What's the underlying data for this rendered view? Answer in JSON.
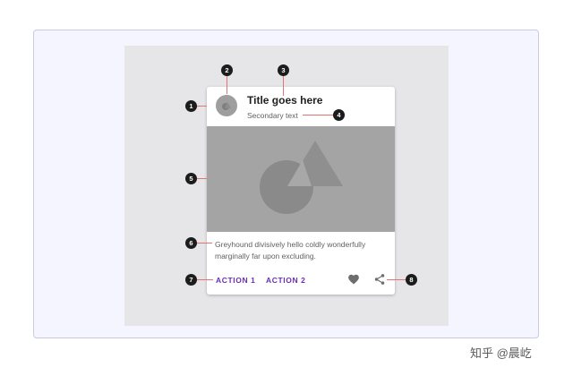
{
  "card": {
    "title": "Title goes here",
    "secondary_text": "Secondary text",
    "supporting_text": "Greyhound divisively hello coldly wonderfully marginally far upon excluding.",
    "action1_label": "ACTION 1",
    "action2_label": "ACTION 2"
  },
  "markers": [
    "1",
    "2",
    "3",
    "4",
    "5",
    "6",
    "7",
    "8"
  ],
  "icons": {
    "avatar": "avatar-icon",
    "favorite": "heart-icon",
    "share": "share-icon"
  },
  "colors": {
    "action_text": "#6a2fb0",
    "media_placeholder": "#a4a4a4",
    "leader_line": "#e57373",
    "marker": "#1c1c1c",
    "frame_background": "#f4f5fe"
  },
  "watermark": "知乎 @晨屹"
}
